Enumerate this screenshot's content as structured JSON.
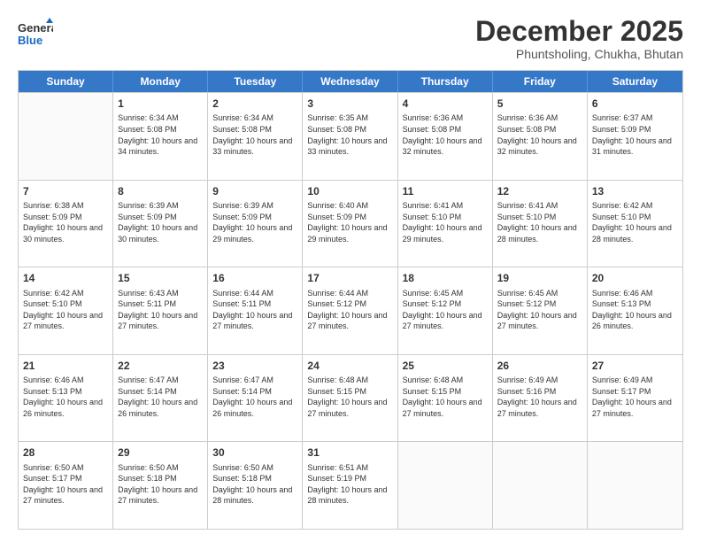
{
  "header": {
    "logo_general": "General",
    "logo_blue": "Blue",
    "month_year": "December 2025",
    "location": "Phuntsholing, Chukha, Bhutan"
  },
  "days_of_week": [
    "Sunday",
    "Monday",
    "Tuesday",
    "Wednesday",
    "Thursday",
    "Friday",
    "Saturday"
  ],
  "weeks": [
    [
      {
        "day": "",
        "sunrise": "",
        "sunset": "",
        "daylight": ""
      },
      {
        "day": "1",
        "sunrise": "Sunrise: 6:34 AM",
        "sunset": "Sunset: 5:08 PM",
        "daylight": "Daylight: 10 hours and 34 minutes."
      },
      {
        "day": "2",
        "sunrise": "Sunrise: 6:34 AM",
        "sunset": "Sunset: 5:08 PM",
        "daylight": "Daylight: 10 hours and 33 minutes."
      },
      {
        "day": "3",
        "sunrise": "Sunrise: 6:35 AM",
        "sunset": "Sunset: 5:08 PM",
        "daylight": "Daylight: 10 hours and 33 minutes."
      },
      {
        "day": "4",
        "sunrise": "Sunrise: 6:36 AM",
        "sunset": "Sunset: 5:08 PM",
        "daylight": "Daylight: 10 hours and 32 minutes."
      },
      {
        "day": "5",
        "sunrise": "Sunrise: 6:36 AM",
        "sunset": "Sunset: 5:08 PM",
        "daylight": "Daylight: 10 hours and 32 minutes."
      },
      {
        "day": "6",
        "sunrise": "Sunrise: 6:37 AM",
        "sunset": "Sunset: 5:09 PM",
        "daylight": "Daylight: 10 hours and 31 minutes."
      }
    ],
    [
      {
        "day": "7",
        "sunrise": "Sunrise: 6:38 AM",
        "sunset": "Sunset: 5:09 PM",
        "daylight": "Daylight: 10 hours and 30 minutes."
      },
      {
        "day": "8",
        "sunrise": "Sunrise: 6:39 AM",
        "sunset": "Sunset: 5:09 PM",
        "daylight": "Daylight: 10 hours and 30 minutes."
      },
      {
        "day": "9",
        "sunrise": "Sunrise: 6:39 AM",
        "sunset": "Sunset: 5:09 PM",
        "daylight": "Daylight: 10 hours and 29 minutes."
      },
      {
        "day": "10",
        "sunrise": "Sunrise: 6:40 AM",
        "sunset": "Sunset: 5:09 PM",
        "daylight": "Daylight: 10 hours and 29 minutes."
      },
      {
        "day": "11",
        "sunrise": "Sunrise: 6:41 AM",
        "sunset": "Sunset: 5:10 PM",
        "daylight": "Daylight: 10 hours and 29 minutes."
      },
      {
        "day": "12",
        "sunrise": "Sunrise: 6:41 AM",
        "sunset": "Sunset: 5:10 PM",
        "daylight": "Daylight: 10 hours and 28 minutes."
      },
      {
        "day": "13",
        "sunrise": "Sunrise: 6:42 AM",
        "sunset": "Sunset: 5:10 PM",
        "daylight": "Daylight: 10 hours and 28 minutes."
      }
    ],
    [
      {
        "day": "14",
        "sunrise": "Sunrise: 6:42 AM",
        "sunset": "Sunset: 5:10 PM",
        "daylight": "Daylight: 10 hours and 27 minutes."
      },
      {
        "day": "15",
        "sunrise": "Sunrise: 6:43 AM",
        "sunset": "Sunset: 5:11 PM",
        "daylight": "Daylight: 10 hours and 27 minutes."
      },
      {
        "day": "16",
        "sunrise": "Sunrise: 6:44 AM",
        "sunset": "Sunset: 5:11 PM",
        "daylight": "Daylight: 10 hours and 27 minutes."
      },
      {
        "day": "17",
        "sunrise": "Sunrise: 6:44 AM",
        "sunset": "Sunset: 5:12 PM",
        "daylight": "Daylight: 10 hours and 27 minutes."
      },
      {
        "day": "18",
        "sunrise": "Sunrise: 6:45 AM",
        "sunset": "Sunset: 5:12 PM",
        "daylight": "Daylight: 10 hours and 27 minutes."
      },
      {
        "day": "19",
        "sunrise": "Sunrise: 6:45 AM",
        "sunset": "Sunset: 5:12 PM",
        "daylight": "Daylight: 10 hours and 27 minutes."
      },
      {
        "day": "20",
        "sunrise": "Sunrise: 6:46 AM",
        "sunset": "Sunset: 5:13 PM",
        "daylight": "Daylight: 10 hours and 26 minutes."
      }
    ],
    [
      {
        "day": "21",
        "sunrise": "Sunrise: 6:46 AM",
        "sunset": "Sunset: 5:13 PM",
        "daylight": "Daylight: 10 hours and 26 minutes."
      },
      {
        "day": "22",
        "sunrise": "Sunrise: 6:47 AM",
        "sunset": "Sunset: 5:14 PM",
        "daylight": "Daylight: 10 hours and 26 minutes."
      },
      {
        "day": "23",
        "sunrise": "Sunrise: 6:47 AM",
        "sunset": "Sunset: 5:14 PM",
        "daylight": "Daylight: 10 hours and 26 minutes."
      },
      {
        "day": "24",
        "sunrise": "Sunrise: 6:48 AM",
        "sunset": "Sunset: 5:15 PM",
        "daylight": "Daylight: 10 hours and 27 minutes."
      },
      {
        "day": "25",
        "sunrise": "Sunrise: 6:48 AM",
        "sunset": "Sunset: 5:15 PM",
        "daylight": "Daylight: 10 hours and 27 minutes."
      },
      {
        "day": "26",
        "sunrise": "Sunrise: 6:49 AM",
        "sunset": "Sunset: 5:16 PM",
        "daylight": "Daylight: 10 hours and 27 minutes."
      },
      {
        "day": "27",
        "sunrise": "Sunrise: 6:49 AM",
        "sunset": "Sunset: 5:17 PM",
        "daylight": "Daylight: 10 hours and 27 minutes."
      }
    ],
    [
      {
        "day": "28",
        "sunrise": "Sunrise: 6:50 AM",
        "sunset": "Sunset: 5:17 PM",
        "daylight": "Daylight: 10 hours and 27 minutes."
      },
      {
        "day": "29",
        "sunrise": "Sunrise: 6:50 AM",
        "sunset": "Sunset: 5:18 PM",
        "daylight": "Daylight: 10 hours and 27 minutes."
      },
      {
        "day": "30",
        "sunrise": "Sunrise: 6:50 AM",
        "sunset": "Sunset: 5:18 PM",
        "daylight": "Daylight: 10 hours and 28 minutes."
      },
      {
        "day": "31",
        "sunrise": "Sunrise: 6:51 AM",
        "sunset": "Sunset: 5:19 PM",
        "daylight": "Daylight: 10 hours and 28 minutes."
      },
      {
        "day": "",
        "sunrise": "",
        "sunset": "",
        "daylight": ""
      },
      {
        "day": "",
        "sunrise": "",
        "sunset": "",
        "daylight": ""
      },
      {
        "day": "",
        "sunrise": "",
        "sunset": "",
        "daylight": ""
      }
    ]
  ]
}
